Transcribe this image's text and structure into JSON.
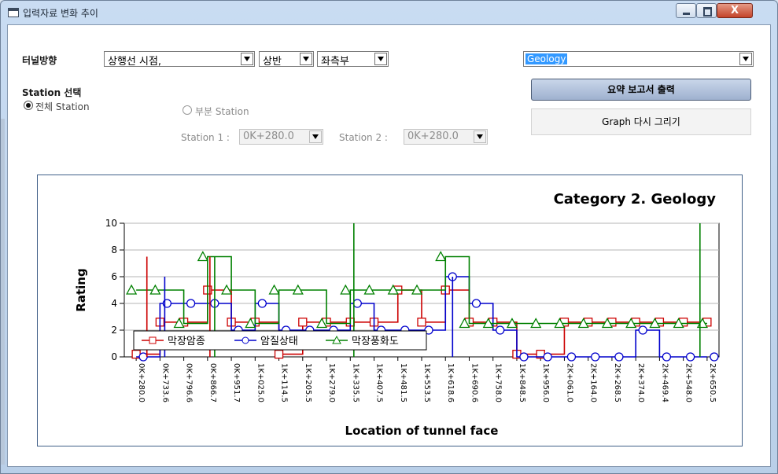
{
  "window": {
    "title": "입력자료 변화 추이",
    "buttons": {
      "minimize": "minimize",
      "maximize": "maximize",
      "close": "X"
    }
  },
  "filters": {
    "tunnel_direction_label": "터널방향",
    "direction_value": "상행선 시점,",
    "half_value": "상반",
    "side_value": "좌측부",
    "category_value": "Geology"
  },
  "station": {
    "section_label": "Station 선택",
    "all_label": "전체 Station",
    "partial_label": "부분 Station",
    "all_selected": true,
    "station1_label": "Station 1 :",
    "station1_value": "0K+280.0",
    "station2_label": "Station 2 :",
    "station2_value": "0K+280.0"
  },
  "buttons": {
    "report": "요약 보고서 출력",
    "redraw": "Graph 다시 그리기"
  },
  "chart_data": {
    "type": "line",
    "title": "Category 2. Geology",
    "xlabel": "Location of tunnel face",
    "ylabel": "Rating",
    "ylim": [
      0,
      10
    ],
    "yticks": [
      0,
      2,
      4,
      6,
      8,
      10
    ],
    "grid": true,
    "legend_position": "bottom-left",
    "categories": [
      "0K+280.0",
      "0K+733.6",
      "0K+796.6",
      "0K+866.7",
      "0K+951.7",
      "1K+025.0",
      "1K+114.5",
      "1K+205.5",
      "1K+279.0",
      "1K+335.5",
      "1K+407.5",
      "1K+481.5",
      "1K+553.5",
      "1K+618.6",
      "1K+690.6",
      "1K+758.0",
      "1K+848.5",
      "1K+956.0",
      "2K+061.0",
      "2K+164.0",
      "2K+268.5",
      "2K+374.0",
      "2K+469.4",
      "2K+548.0",
      "2K+650.5"
    ],
    "series": [
      {
        "name": "막장암종",
        "color": "#cc0000",
        "marker": "square",
        "values": [
          0.2,
          2.6,
          2.6,
          5.0,
          2.6,
          2.6,
          0.2,
          2.6,
          2.6,
          2.6,
          2.6,
          5.0,
          2.6,
          5.0,
          2.6,
          2.6,
          0.2,
          0.2,
          2.6,
          2.6,
          2.6,
          2.6,
          2.6,
          2.6,
          2.6
        ]
      },
      {
        "name": "암질상태",
        "color": "#0000cc",
        "marker": "circle",
        "values": [
          0.0,
          4.0,
          4.0,
          4.0,
          2.0,
          4.0,
          2.0,
          2.0,
          2.0,
          4.0,
          2.0,
          2.0,
          2.0,
          6.0,
          4.0,
          2.0,
          0.0,
          0.0,
          0.0,
          0.0,
          0.0,
          2.0,
          0.0,
          0.0,
          0.0
        ]
      },
      {
        "name": "막장풍화도",
        "color": "#008000",
        "marker": "triangle",
        "values": [
          5.0,
          5.0,
          2.5,
          7.5,
          5.0,
          2.5,
          5.0,
          5.0,
          2.5,
          5.0,
          5.0,
          5.0,
          5.0,
          7.5,
          2.5,
          2.5,
          2.5,
          2.5,
          2.5,
          2.5,
          2.5,
          2.5,
          2.5,
          2.5,
          2.5
        ]
      }
    ],
    "spikes": [
      {
        "series": 2,
        "at": 9.15,
        "value": 10.0
      },
      {
        "series": 2,
        "at": 23.7,
        "value": 10.0
      },
      {
        "series": 2,
        "at": 3.3,
        "value": 7.5
      },
      {
        "series": 0,
        "at": 0.45,
        "value": 7.5
      },
      {
        "series": 0,
        "at": 3.1,
        "value": 7.5
      },
      {
        "series": 1,
        "at": 1.2,
        "value": 6.0
      },
      {
        "series": 1,
        "at": 13.3,
        "value": 6.0
      }
    ]
  }
}
